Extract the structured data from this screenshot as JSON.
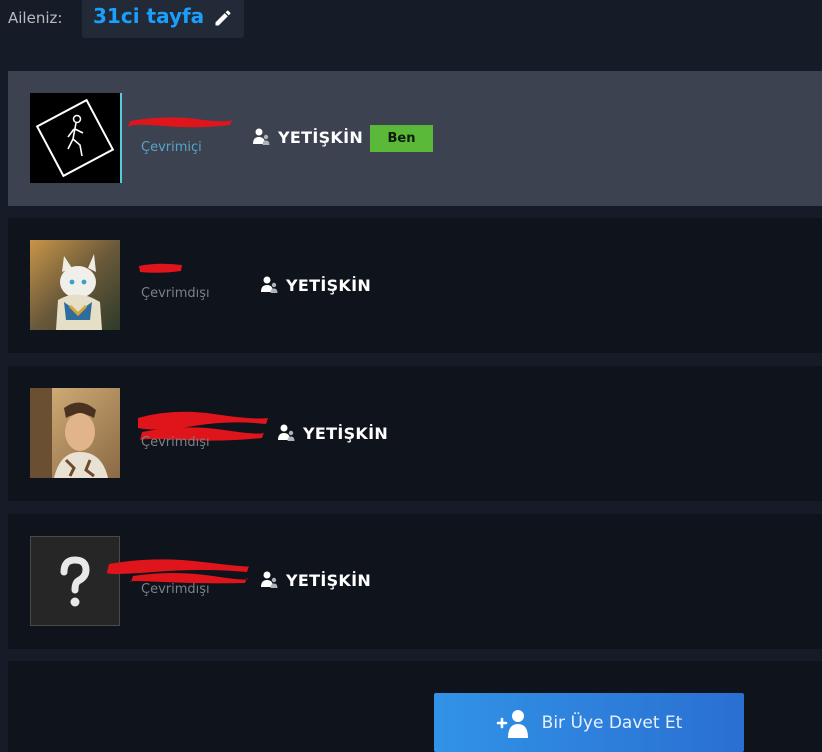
{
  "family": {
    "prefix": "Aileniz:",
    "name": "31ci tayfa"
  },
  "members": [
    {
      "status": "Çevrimiçi",
      "role": "YETİŞKİN",
      "badge": "Ben"
    },
    {
      "status": "Çevrimdışı",
      "role": "YETİŞKİN"
    },
    {
      "status": "Çevrimdışı",
      "role": "YETİŞKİN"
    },
    {
      "status": "Çevrimdışı",
      "role": "YETİŞKİN"
    }
  ],
  "invite": {
    "label": "Bir Üye Davet Et"
  },
  "colors": {
    "accent": "#1a9fff",
    "badge": "#5bb93a",
    "redaction": "#e0151b",
    "online": "#57a4c9"
  },
  "icons": {
    "edit": "pencil-icon",
    "role": "adult-user-icon",
    "invite": "add-user-icon",
    "unknown_avatar": "question-mark-icon"
  }
}
